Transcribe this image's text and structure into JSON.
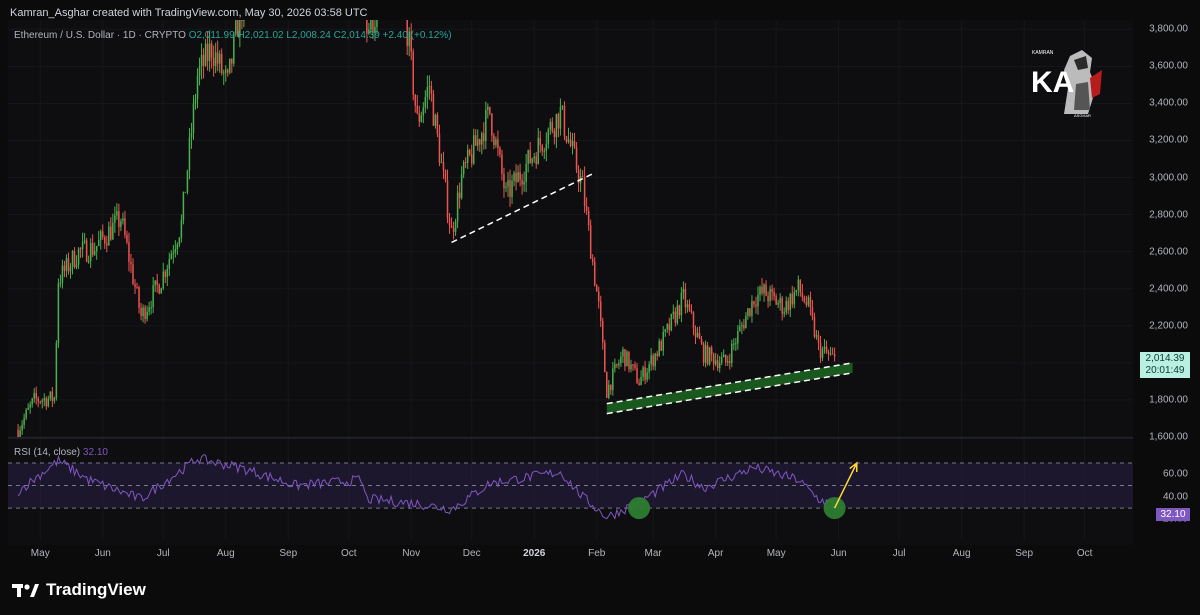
{
  "header": {
    "credit": "Kamran_Asghar created with TradingView.com, May 30, 2026 03:58 UTC"
  },
  "legend": {
    "symbol": "Ethereum / U.S. Dollar · 1D · CRYPTO",
    "open": "O2,011.99",
    "high": "H2,021.02",
    "low": "L2,008.24",
    "close": "C2,014.39",
    "change": "+2.40 (+0.12%)"
  },
  "price_tag": {
    "price": "2,014.39",
    "countdown": "20:01:49"
  },
  "rsi": {
    "label": "RSI (14, close)",
    "value": "32.10",
    "tag": "32.10"
  },
  "y_ticks": [
    "3,800.00",
    "3,600.00",
    "3,400.00",
    "3,200.00",
    "3,000.00",
    "2,800.00",
    "2,600.00",
    "2,400.00",
    "2,200.00",
    "2,000.00",
    "1,800.00",
    "1,600.00"
  ],
  "rsi_ticks": [
    "60.00",
    "40.00",
    "20.00"
  ],
  "x_ticks": [
    "May",
    "Jun",
    "Jul",
    "Aug",
    "Sep",
    "Oct",
    "Nov",
    "Dec",
    "2026",
    "Feb",
    "Mar",
    "Apr",
    "May",
    "Jun",
    "Jul",
    "Aug",
    "Sep",
    "Oct"
  ],
  "brand": {
    "name": "TradingView"
  },
  "logo": {
    "text_top": "KAMRAN",
    "text_initials": "KA",
    "text_bottom": "ASGHAR"
  },
  "colors": {
    "up": "#26a69a",
    "down": "#ef5350",
    "up_bright": "#4caf50",
    "rsi_line": "#7e57c2",
    "rsi_band": "#2a1f45",
    "support_band": "#1b5e20",
    "arrow": "#fdd835"
  },
  "chart_data": {
    "type": "candlestick",
    "title": "Ethereum / U.S. Dollar · 1D · CRYPTO",
    "ylim": [
      1600,
      3850
    ],
    "x_range": [
      "2025-04-15",
      "2026-10-25"
    ],
    "y_scale": "price (USD)",
    "anchors": [
      [
        "2025-04-20",
        1640
      ],
      [
        "2025-04-28",
        1800
      ],
      [
        "2025-05-08",
        1810
      ],
      [
        "2025-05-10",
        2450
      ],
      [
        "2025-05-20",
        2600
      ],
      [
        "2025-05-28",
        2620
      ],
      [
        "2025-06-10",
        2780
      ],
      [
        "2025-06-20",
        2250
      ],
      [
        "2025-06-30",
        2450
      ],
      [
        "2025-07-10",
        2750
      ],
      [
        "2025-07-18",
        3550
      ],
      [
        "2025-07-25",
        3700
      ],
      [
        "2025-08-02",
        3500
      ],
      [
        "2025-08-08",
        3900
      ],
      [
        "2025-08-25",
        4400
      ],
      [
        "2025-09-20",
        4400
      ],
      [
        "2025-10-07",
        4600
      ],
      [
        "2025-10-10",
        3800
      ],
      [
        "2025-10-27",
        4100
      ],
      [
        "2025-11-04",
        3300
      ],
      [
        "2025-11-10",
        3500
      ],
      [
        "2025-11-21",
        2700
      ],
      [
        "2025-11-26",
        3000
      ],
      [
        "2025-12-10",
        3350
      ],
      [
        "2025-12-18",
        2900
      ],
      [
        "2026-01-05",
        3200
      ],
      [
        "2026-01-14",
        3350
      ],
      [
        "2026-01-25",
        2950
      ],
      [
        "2026-02-02",
        2300
      ],
      [
        "2026-02-06",
        1850
      ],
      [
        "2026-02-14",
        2050
      ],
      [
        "2026-02-22",
        1900
      ],
      [
        "2026-03-05",
        2100
      ],
      [
        "2026-03-16",
        2350
      ],
      [
        "2026-03-26",
        2050
      ],
      [
        "2026-04-06",
        2000
      ],
      [
        "2026-04-20",
        2350
      ],
      [
        "2026-04-25",
        2380
      ],
      [
        "2026-05-05",
        2300
      ],
      [
        "2026-05-12",
        2400
      ],
      [
        "2026-05-17",
        2300
      ],
      [
        "2026-05-22",
        2080
      ],
      [
        "2026-05-30",
        2014.39
      ]
    ],
    "rsi_series": {
      "name": "RSI (14, close)",
      "ylim": [
        15,
        78
      ],
      "levels": [
        70,
        50,
        30
      ],
      "anchors": [
        [
          "2025-04-20",
          45
        ],
        [
          "2025-05-10",
          72
        ],
        [
          "2025-05-25",
          55
        ],
        [
          "2025-06-20",
          38
        ],
        [
          "2025-07-18",
          74
        ],
        [
          "2025-08-08",
          66
        ],
        [
          "2025-09-05",
          50
        ],
        [
          "2025-10-07",
          55
        ],
        [
          "2025-10-10",
          38
        ],
        [
          "2025-11-04",
          34
        ],
        [
          "2025-11-21",
          29
        ],
        [
          "2025-12-10",
          52
        ],
        [
          "2026-01-14",
          62
        ],
        [
          "2026-01-25",
          40
        ],
        [
          "2026-02-06",
          22
        ],
        [
          "2026-02-22",
          35
        ],
        [
          "2026-03-16",
          60
        ],
        [
          "2026-03-26",
          48
        ],
        [
          "2026-04-20",
          66
        ],
        [
          "2026-05-12",
          55
        ],
        [
          "2026-05-22",
          38
        ],
        [
          "2026-05-30",
          32.1
        ]
      ]
    },
    "annotations": {
      "trend_line_1": {
        "from": [
          "2025-11-21",
          2650
        ],
        "to": [
          "2026-01-30",
          3020
        ],
        "style": "dashed"
      },
      "support_band": {
        "from": [
          "2026-02-06",
          1780
        ],
        "to": [
          "2026-05-30",
          2000
        ],
        "style": "dashed band"
      },
      "rsi_circles": [
        [
          "2026-02-22",
          30
        ],
        [
          "2026-05-30",
          30
        ]
      ],
      "rsi_arrow": {
        "from": [
          "2026-05-30",
          30
        ],
        "to": [
          "2026-06-10",
          70
        ]
      }
    }
  }
}
